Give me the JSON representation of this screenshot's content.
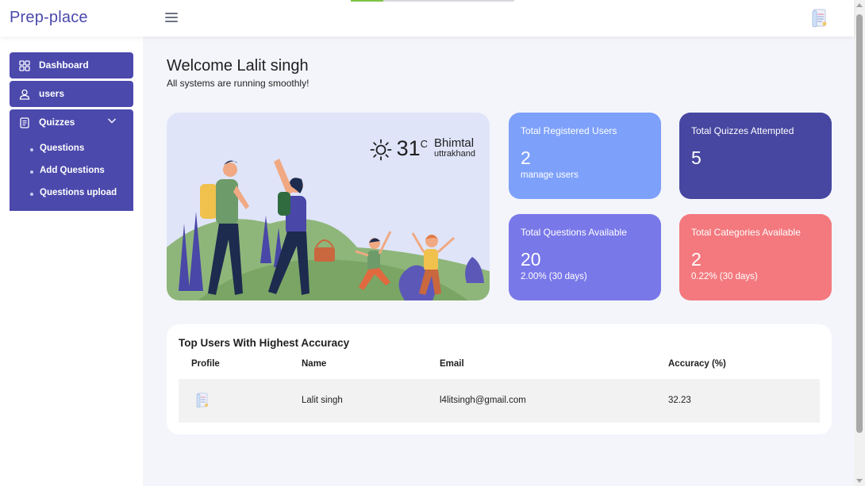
{
  "app": {
    "brand": "Prep-place"
  },
  "header": {
    "menu_icon": "hamburger-icon",
    "avatar_icon": "user-avatar-icon",
    "loading_progress": 0.2
  },
  "sidebar": {
    "items": [
      {
        "label": "Dashboard",
        "icon": "grid-icon"
      },
      {
        "label": "users",
        "icon": "user-icon"
      },
      {
        "label": "Quizzes",
        "icon": "document-icon",
        "expanded": true,
        "children": [
          {
            "label": "Questions"
          },
          {
            "label": "Add Questions"
          },
          {
            "label": "Questions upload"
          }
        ]
      }
    ]
  },
  "main": {
    "welcome": "Welcome Lalit singh",
    "status": "All systems are running smoothly!",
    "weather": {
      "icon": "sun-icon",
      "temp": "31",
      "unit": "C",
      "city": "Bhimtal",
      "region": "uttrakhand"
    },
    "stats": [
      {
        "title": "Total Registered Users",
        "value": "2",
        "sub": "manage users",
        "color": "#7da0fa"
      },
      {
        "title": "Total Quizzes Attempted",
        "value": "5",
        "sub": "",
        "color": "#4747a1"
      },
      {
        "title": "Total Questions Available",
        "value": "20",
        "sub": "2.00% (30 days)",
        "color": "#7978e9"
      },
      {
        "title": "Total Categories Available",
        "value": "2",
        "sub": "0.22% (30 days)",
        "color": "#f3797e"
      }
    ],
    "top_users": {
      "title": "Top Users With Highest Accuracy",
      "columns": [
        "Profile",
        "Name",
        "Email",
        "Accuracy (%)"
      ],
      "rows": [
        {
          "name": "Lalit singh",
          "email": "l4litsingh@gmail.com",
          "accuracy": "32.23"
        }
      ]
    }
  },
  "colors": {
    "primary": "#4b49ac",
    "background": "#f4f5fb"
  }
}
